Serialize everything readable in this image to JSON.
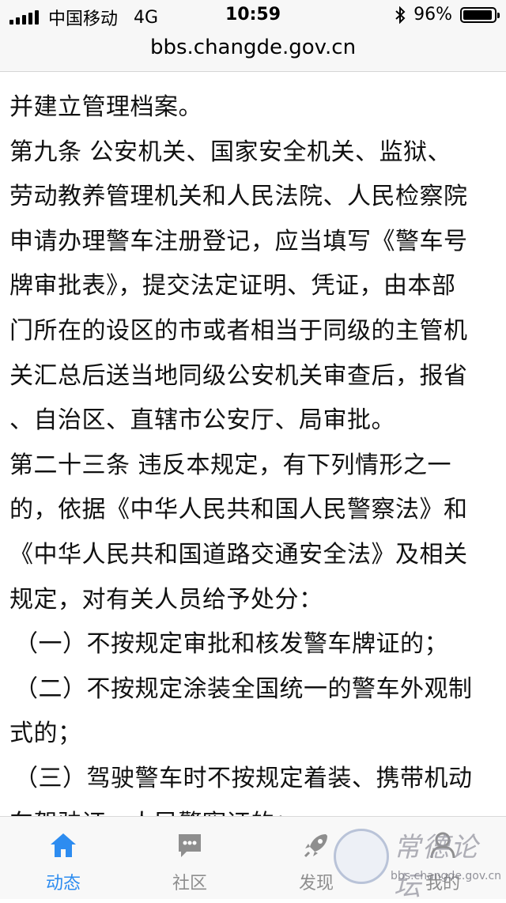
{
  "status_bar": {
    "carrier": "中国移动",
    "network": "4G",
    "time": "10:59",
    "battery": "96%",
    "battery_level": 0.96
  },
  "browser": {
    "url": "bbs.changde.gov.cn"
  },
  "article": {
    "lines": [
      "并建立管理档案。",
      "第九条  公安机关、国家安全机关、监狱、",
      "劳动教养管理机关和人民法院、人民检察院",
      "申请办理警车注册登记，应当填写《警车号",
      "牌审批表》，提交法定证明、凭证，由本部",
      "门所在的设区的市或者相当于同级的主管机",
      "关汇总后送当地同级公安机关审查后，报省",
      "、自治区、直辖市公安厅、局审批。",
      "第二十三条  违反本规定，有下列情形之一",
      "的，依据《中华人民共和国人民警察法》和",
      "《中华人民共和国道路交通安全法》及相关",
      "规定，对有关人员给予处分：",
      "（一）不按规定审批和核发警车牌证的；",
      "（二）不按规定涂装全国统一的警车外观制",
      "式的；",
      "（三）驾驶警车时不按规定着装、携带机动",
      "车驾驶证、人民警察证的；"
    ]
  },
  "tab_bar": {
    "tabs": [
      {
        "label": "动态",
        "icon": "home-icon",
        "active": true
      },
      {
        "label": "社区",
        "icon": "chat-bubble-icon",
        "active": false
      },
      {
        "label": "发现",
        "icon": "rocket-icon",
        "active": false
      },
      {
        "label": "我的",
        "icon": "person-icon",
        "active": false
      }
    ],
    "active_color": "#2d8cf0",
    "inactive_color": "#8e8e8e"
  },
  "watermark": {
    "text": "常德论坛",
    "url": "bbs.changde.gov.cn"
  }
}
